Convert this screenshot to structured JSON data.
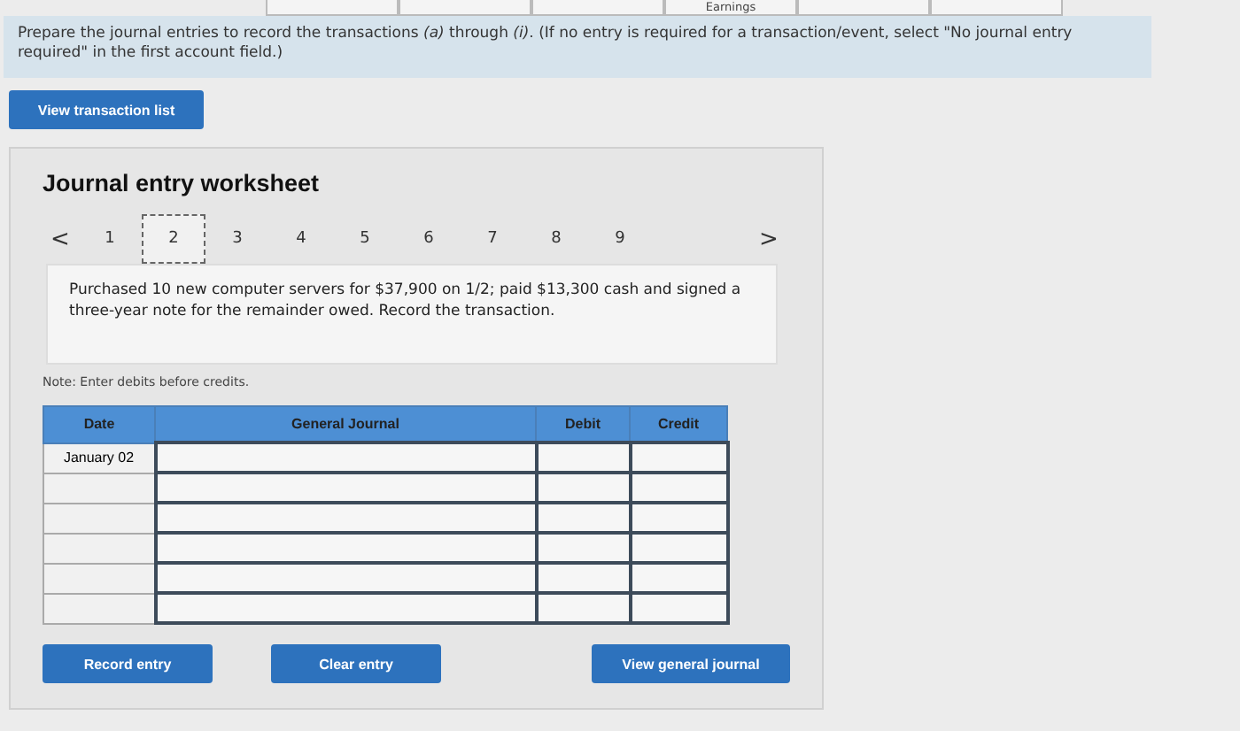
{
  "top_strip": {
    "label": "Earnings"
  },
  "instructions": "Prepare the journal entries to record the transactions *(a)* through *(i)*. (If no entry is required for a transaction/event, select \"No journal entry required\" in the first account field.)",
  "view_transaction_list": "View transaction list",
  "worksheet": {
    "title": "Journal entry worksheet",
    "prev": "<",
    "next": ">",
    "tabs": [
      {
        "label": "1",
        "selected": false
      },
      {
        "label": "2",
        "selected": true
      },
      {
        "label": "3",
        "selected": false
      },
      {
        "label": "4",
        "selected": false
      },
      {
        "label": "5",
        "selected": false
      },
      {
        "label": "6",
        "selected": false
      },
      {
        "label": "7",
        "selected": false
      },
      {
        "label": "8",
        "selected": false
      },
      {
        "label": "9",
        "selected": false
      }
    ],
    "description": "Purchased 10 new computer servers for $37,900 on 1/2; paid $13,300 cash and signed a three-year note for the remainder owed. Record the transaction.",
    "note": "Note: Enter debits before credits.",
    "table": {
      "columns": [
        "Date",
        "General Journal",
        "Debit",
        "Credit"
      ],
      "rows": [
        {
          "date": "January 02"
        },
        {
          "date": ""
        },
        {
          "date": ""
        },
        {
          "date": ""
        },
        {
          "date": ""
        },
        {
          "date": ""
        }
      ]
    },
    "buttons": [
      "Record entry",
      "Clear entry",
      "View general journal"
    ]
  }
}
